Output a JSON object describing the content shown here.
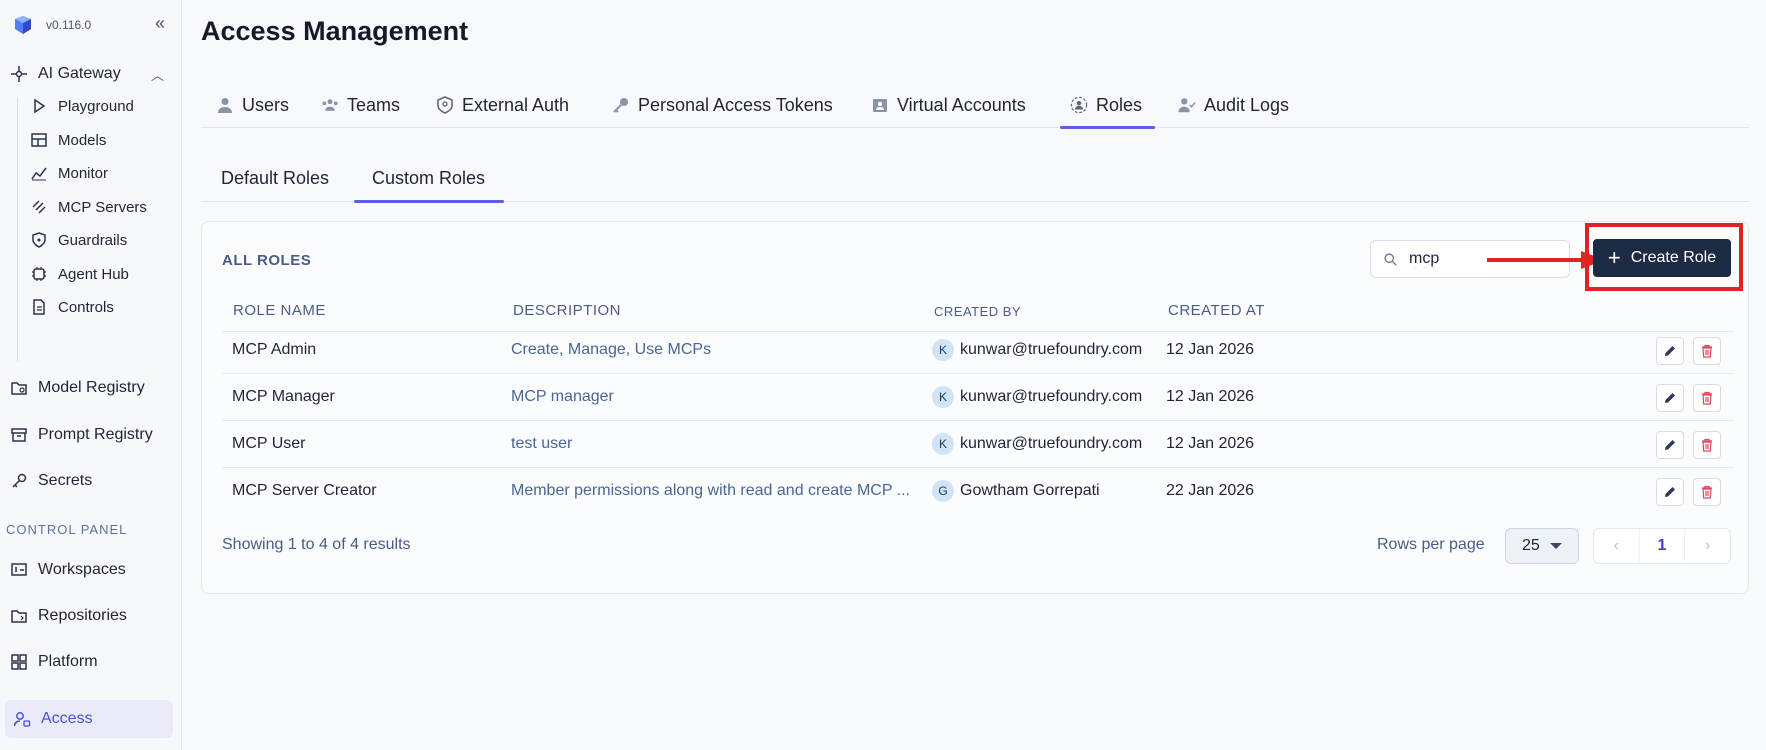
{
  "sidebar": {
    "version": "v0.116.0",
    "gateway": {
      "label": "AI Gateway",
      "items": [
        "Playground",
        "Models",
        "Monitor",
        "MCP Servers",
        "Guardrails",
        "Agent Hub",
        "Controls"
      ]
    },
    "main_items": [
      "Model Registry",
      "Prompt Registry",
      "Secrets"
    ],
    "section_label": "CONTROL PANEL",
    "panel_items": [
      "Workspaces",
      "Repositories",
      "Platform"
    ],
    "active_item": "Access"
  },
  "page": {
    "title": "Access Management"
  },
  "tabs": [
    "Users",
    "Teams",
    "External Auth",
    "Personal Access Tokens",
    "Virtual Accounts",
    "Roles",
    "Audit Logs"
  ],
  "active_tab": "Roles",
  "subtabs": [
    "Default Roles",
    "Custom Roles"
  ],
  "active_subtab": "Custom Roles",
  "roles_card": {
    "title": "ALL ROLES",
    "search_value": "mcp",
    "create_label": "Create Role",
    "columns": {
      "name": "ROLE NAME",
      "description": "DESCRIPTION",
      "created_by": "CREATED BY",
      "created_at": "CREATED AT"
    },
    "rows": [
      {
        "name": "MCP Admin",
        "description": "Create, Manage, Use MCPs",
        "initial": "K",
        "created_by": "kunwar@truefoundry.com",
        "created_at": "12 Jan 2026"
      },
      {
        "name": "MCP Manager",
        "description": "MCP manager",
        "initial": "K",
        "created_by": "kunwar@truefoundry.com",
        "created_at": "12 Jan 2026"
      },
      {
        "name": "MCP User",
        "description": "test user",
        "initial": "K",
        "created_by": "kunwar@truefoundry.com",
        "created_at": "12 Jan 2026"
      },
      {
        "name": "MCP Server Creator",
        "description": "Member permissions along with read and create MCP ...",
        "initial": "G",
        "created_by": "Gowtham Gorrepati",
        "created_at": "22 Jan 2026"
      }
    ],
    "summary": "Showing 1 to 4 of 4 results",
    "rows_per_page_label": "Rows per page",
    "rows_per_page": "25",
    "current_page": "1"
  },
  "colors": {
    "accent": "#5b5fe0",
    "primary_button": "#1d2a44",
    "annotation": "#e02424",
    "delete": "#e0455a"
  }
}
